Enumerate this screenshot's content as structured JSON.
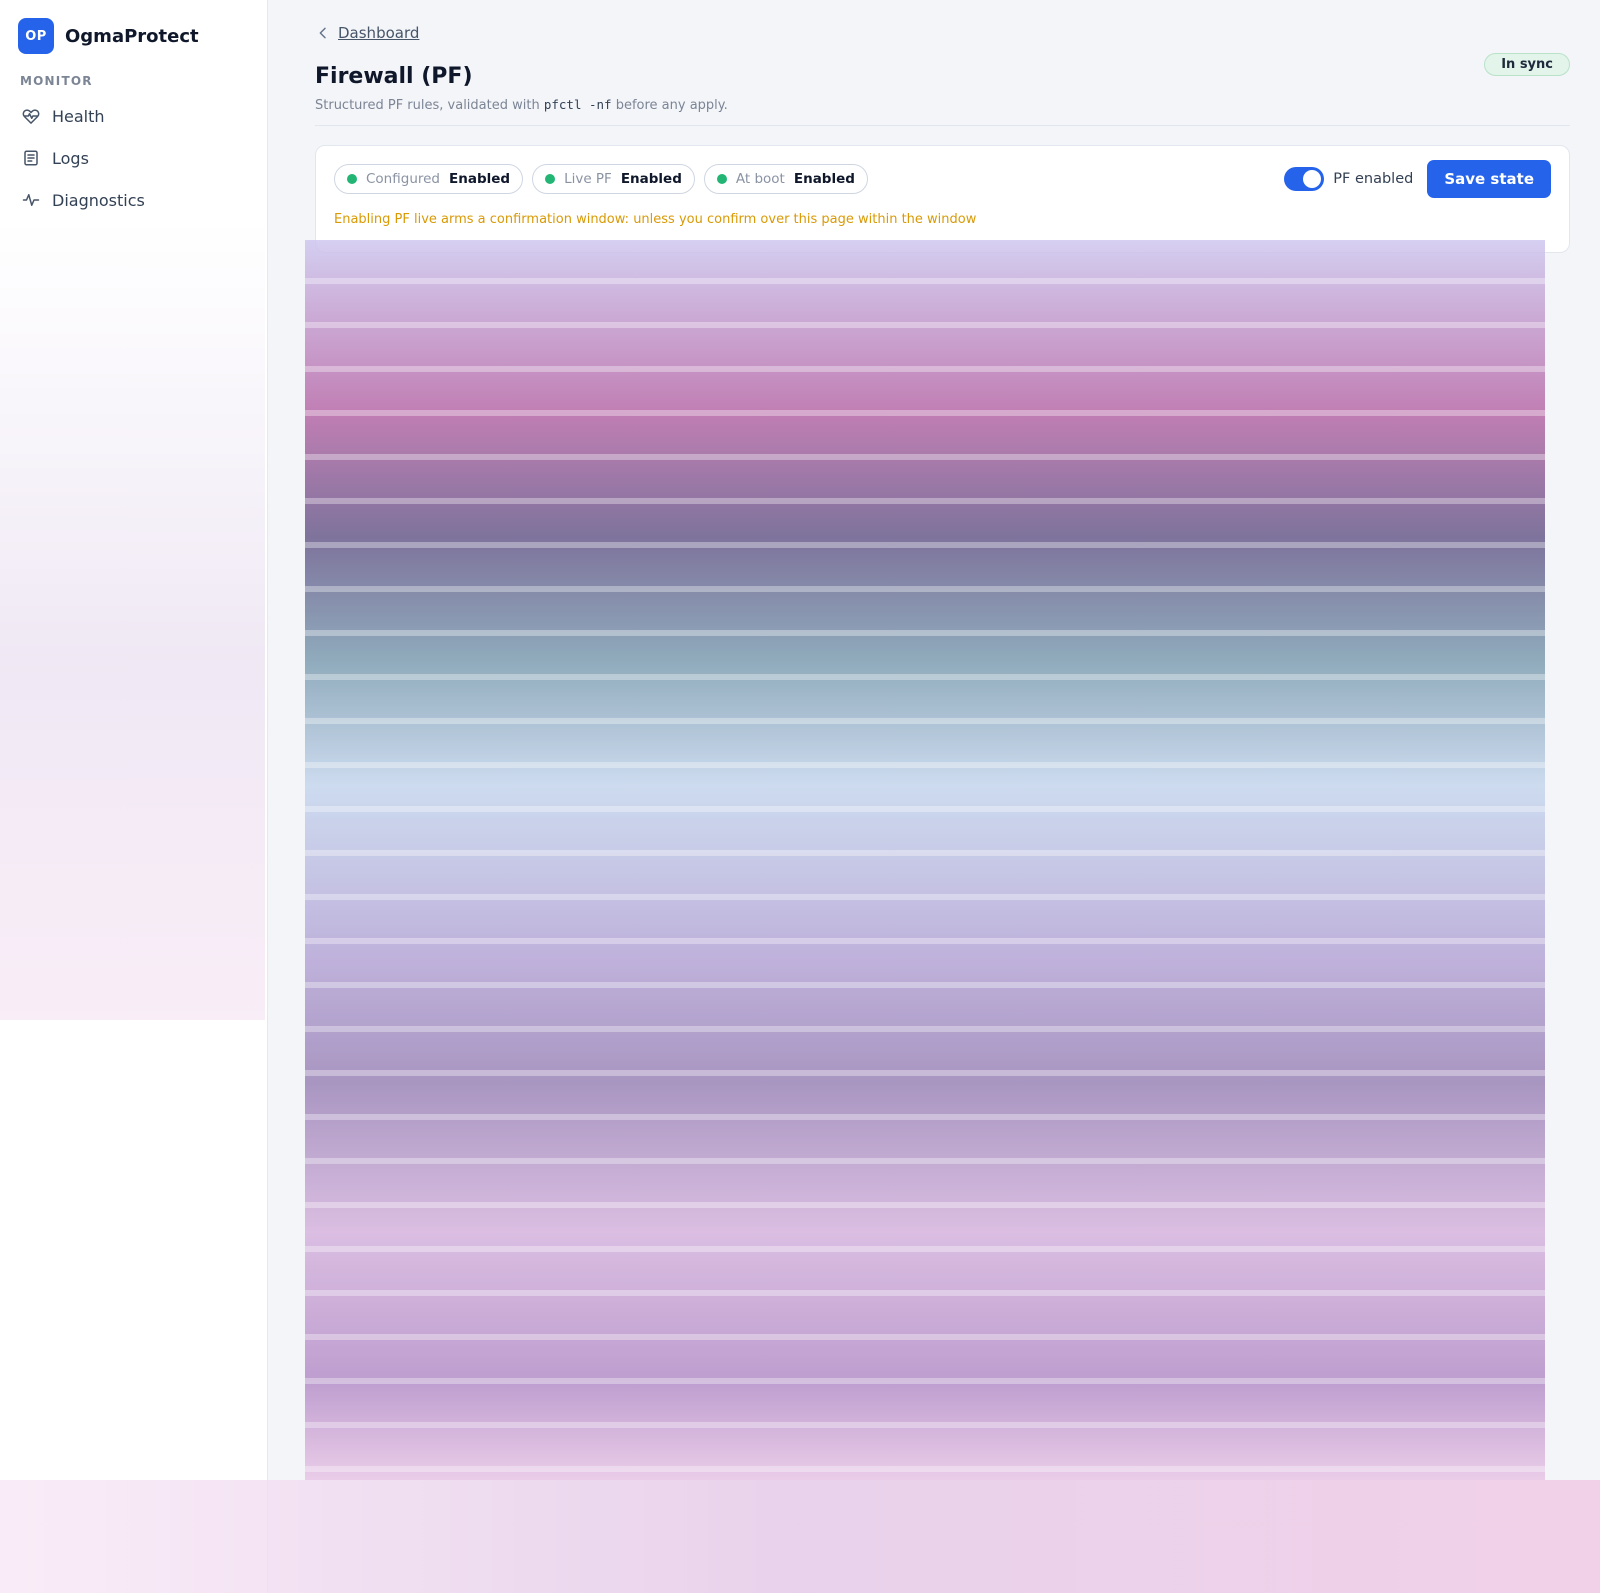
{
  "brand": {
    "logo_text": "OP",
    "name": "OgmaProtect"
  },
  "sidebar": {
    "section_label": "MONITOR",
    "items": [
      {
        "label": "Health",
        "icon": "heart-pulse-icon"
      },
      {
        "label": "Logs",
        "icon": "document-lines-icon"
      },
      {
        "label": "Diagnostics",
        "icon": "activity-icon"
      }
    ]
  },
  "breadcrumb": {
    "label": "Dashboard"
  },
  "header": {
    "title": "Firewall (PF)",
    "subtitle_before": "Structured PF rules, validated with ",
    "subtitle_code": "pfctl -nf",
    "subtitle_after": " before any apply.",
    "sync_badge": "In sync"
  },
  "status_card": {
    "pills": [
      {
        "key": "Configured",
        "value": "Enabled"
      },
      {
        "key": "Live PF",
        "value": "Enabled"
      },
      {
        "key": "At boot",
        "value": "Enabled"
      }
    ],
    "toggle_label": "PF enabled",
    "toggle_on": true,
    "save_label": "Save state",
    "warning": "Enabling PF live arms a confirmation window: unless you confirm over this page within the window"
  },
  "colors": {
    "accent": "#2563eb",
    "status_ok": "#22b573",
    "warning": "#d99a06"
  }
}
